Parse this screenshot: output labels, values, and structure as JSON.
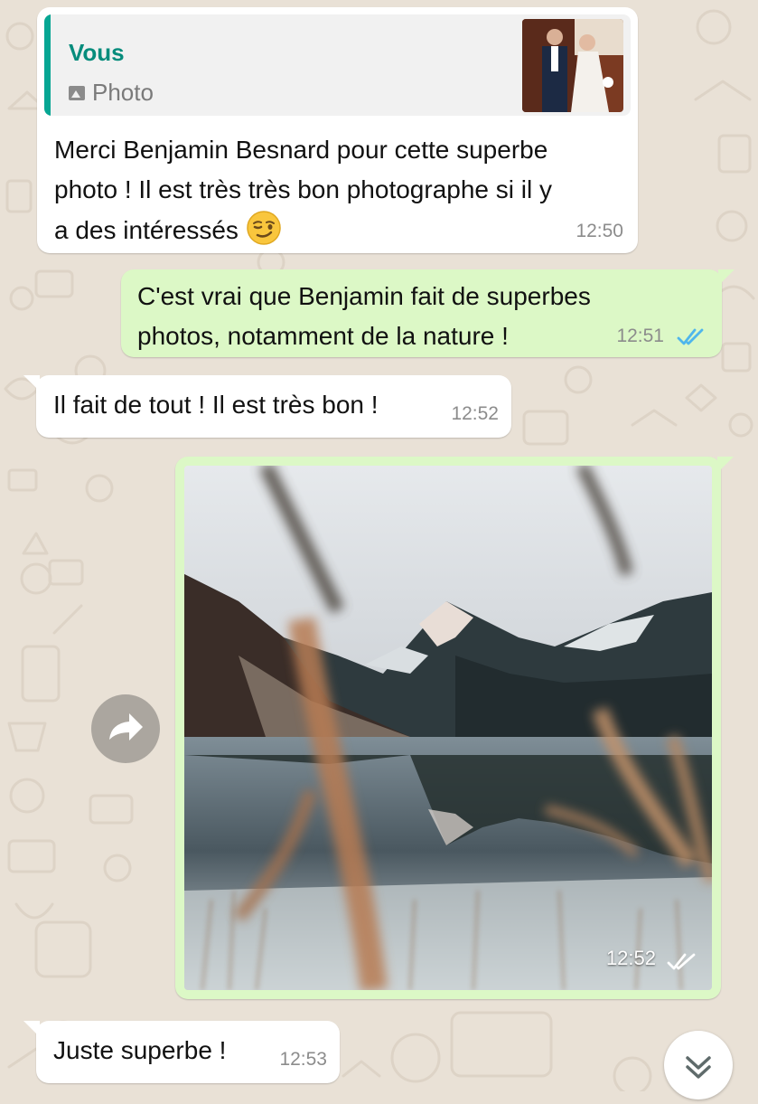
{
  "messages": [
    {
      "direction": "incoming",
      "quote_author": "Vous",
      "quote_type": "Photo",
      "text_lines": [
        "Merci Benjamin Besnard pour cette superbe",
        "photo ! Il est très très bon photographe si il y",
        "a des intéressés"
      ],
      "emoji": "smirking-face-emoji",
      "time": "12:50"
    },
    {
      "direction": "outgoing",
      "text_lines": [
        "C'est vrai que Benjamin fait de superbes",
        "photos, notamment de la nature !"
      ],
      "time": "12:51",
      "status": "read"
    },
    {
      "direction": "incoming",
      "text": "Il fait de tout ! Il est très bon !",
      "time": "12:52"
    },
    {
      "direction": "outgoing",
      "type": "image",
      "image": "mountain-lake-reflection-photo",
      "time": "12:52",
      "status": "read"
    },
    {
      "direction": "incoming",
      "text": "Juste superbe !",
      "time": "12:53"
    }
  ],
  "controls": {
    "forward_icon": "forward-arrow-icon",
    "scroll_icon": "double-chevron-down-icon"
  },
  "colors": {
    "wallpaper": "#e9e1d6",
    "incoming_bubble": "#ffffff",
    "outgoing_bubble": "#dcf8c6",
    "quote_accent": "#06a693",
    "read_ticks": "#4fb6ec"
  }
}
